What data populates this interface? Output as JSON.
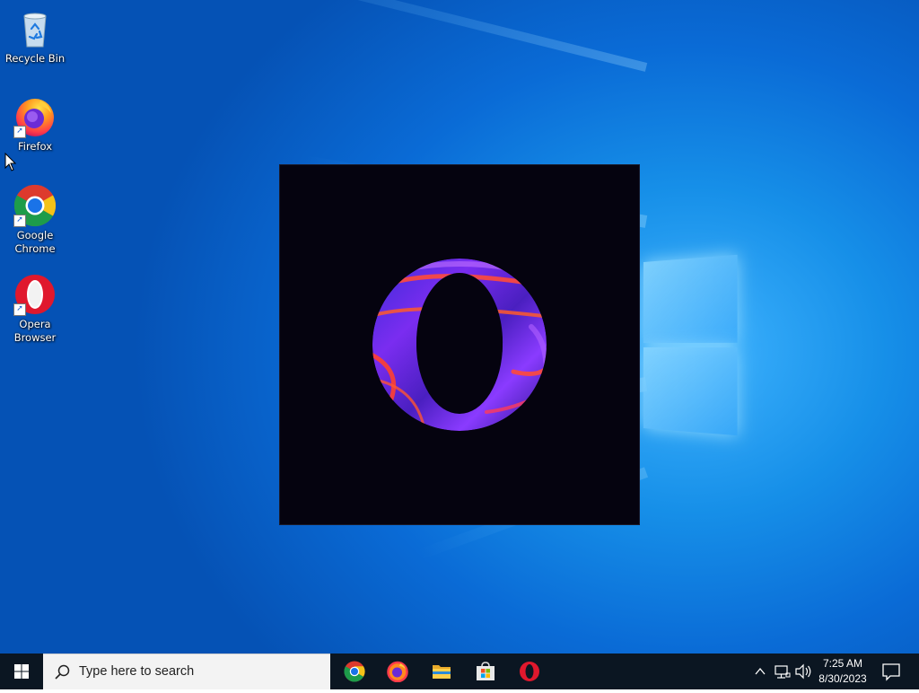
{
  "desktop": {
    "icons": [
      {
        "label": "Recycle Bin",
        "icon": "recycle-bin-icon"
      },
      {
        "label": "Firefox",
        "icon": "firefox-icon",
        "shortcut": true
      },
      {
        "label": "Google Chrome",
        "icon": "chrome-icon",
        "shortcut": true
      },
      {
        "label": "Opera Browser",
        "icon": "opera-icon",
        "shortcut": true
      }
    ]
  },
  "splash": {
    "app": "Opera",
    "logo": "opera-o-logo",
    "background": "#05030f"
  },
  "taskbar": {
    "search_placeholder": "Type here to search",
    "pinned": [
      "chrome-icon",
      "firefox-icon",
      "file-explorer-icon",
      "microsoft-store-icon",
      "opera-icon"
    ],
    "tray": {
      "time": "7:25 AM",
      "date": "8/30/2023"
    }
  },
  "colors": {
    "taskbar": "#0b1622",
    "desktop_accent": "#0a6bd6",
    "opera_red": "#e0182d"
  }
}
